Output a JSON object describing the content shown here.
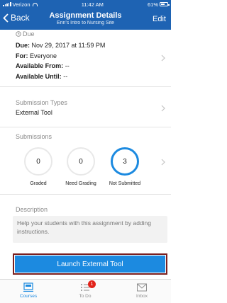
{
  "status_bar": {
    "carrier": "Verizon",
    "time": "11:42 AM",
    "battery": "61%",
    "battery_level": 0.61
  },
  "nav": {
    "back_label": "Back",
    "title": "Assignment Details",
    "subtitle": "Erin's Intro to Nursing Site",
    "edit_label": "Edit"
  },
  "due": {
    "heading": "Due",
    "due_label": "Due:",
    "due_value": "Nov 29, 2017 at 11:59 PM",
    "for_label": "For:",
    "for_value": "Everyone",
    "from_label": "Available From:",
    "from_value": "--",
    "until_label": "Available Until:",
    "until_value": "--"
  },
  "submission_types": {
    "label": "Submission Types",
    "value": "External Tool"
  },
  "submissions": {
    "label": "Submissions",
    "stats": [
      {
        "count": "0",
        "caption": "Graded"
      },
      {
        "count": "0",
        "caption": "Need Grading"
      },
      {
        "count": "3",
        "caption": "Not Submitted"
      }
    ]
  },
  "description": {
    "label": "Description",
    "placeholder_text": "Help your students with this assignment by adding instructions."
  },
  "launch_button": {
    "label": "Launch External Tool"
  },
  "tab_bar": {
    "items": [
      {
        "label": "Courses",
        "icon": "courses-icon",
        "active": true
      },
      {
        "label": "To Do",
        "icon": "todo-icon",
        "badge": "1"
      },
      {
        "label": "Inbox",
        "icon": "inbox-icon"
      }
    ]
  },
  "colors": {
    "brand": "#1e63b3",
    "accent": "#1c8ae0",
    "badge": "#e2231a",
    "highlight_border": "#7a1f1f"
  }
}
